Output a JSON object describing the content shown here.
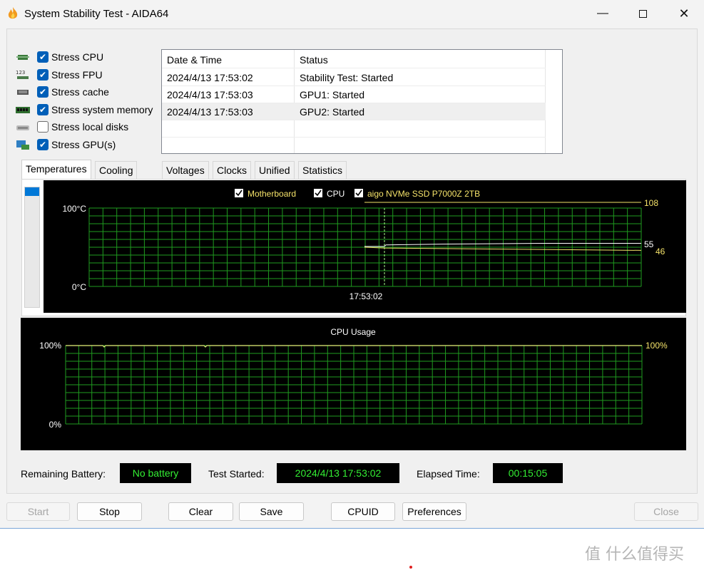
{
  "window": {
    "title": "System Stability Test - AIDA64"
  },
  "stress_items": [
    {
      "label": "Stress CPU",
      "checked": true,
      "icon": "cpu-icon"
    },
    {
      "label": "Stress FPU",
      "checked": true,
      "icon": "fpu-icon"
    },
    {
      "label": "Stress cache",
      "checked": true,
      "icon": "cache-icon"
    },
    {
      "label": "Stress system memory",
      "checked": true,
      "icon": "memory-icon"
    },
    {
      "label": "Stress local disks",
      "checked": false,
      "icon": "disk-icon"
    },
    {
      "label": "Stress GPU(s)",
      "checked": true,
      "icon": "gpu-icon"
    }
  ],
  "log": {
    "headers": [
      "Date & Time",
      "Status"
    ],
    "rows": [
      [
        "2024/4/13 17:53:02",
        "Stability Test: Started"
      ],
      [
        "2024/4/13 17:53:03",
        "GPU1: Started"
      ],
      [
        "2024/4/13 17:53:03",
        "GPU2: Started"
      ]
    ]
  },
  "tabs": [
    "Temperatures",
    "Cooling Fans",
    "Voltages",
    "Clocks",
    "Unified",
    "Statistics"
  ],
  "temp_chart": {
    "legend": [
      {
        "label": "Motherboard",
        "checked": true,
        "color": "#f5e36a"
      },
      {
        "label": "CPU",
        "checked": true,
        "color": "#ffffff"
      },
      {
        "label": "aigo NVMe SSD P7000Z 2TB",
        "checked": true,
        "color": "#f5e36a"
      }
    ],
    "y_top": "100°C",
    "y_bottom": "0°C",
    "x_label": "17:53:02",
    "right_values": [
      "108",
      "55",
      "46"
    ]
  },
  "cpu_chart": {
    "title": "CPU Usage",
    "y_top": "100%",
    "y_bottom": "0%",
    "right_value": "100%"
  },
  "chart_data": [
    {
      "type": "line",
      "title": "",
      "ylim": [
        0,
        100
      ],
      "unit": "°C",
      "series": [
        {
          "name": "Motherboard",
          "color": "#f5e36a",
          "current": 46
        },
        {
          "name": "CPU",
          "color": "#ffffff",
          "current": 55
        },
        {
          "name": "aigo NVMe SSD P7000Z 2TB",
          "color": "#f5e36a",
          "current": 108
        }
      ]
    },
    {
      "type": "line",
      "title": "CPU Usage",
      "ylim": [
        0,
        100
      ],
      "unit": "%",
      "series": [
        {
          "name": "CPU Usage",
          "current": 100
        }
      ]
    }
  ],
  "status": {
    "battery_label": "Remaining Battery:",
    "battery_value": "No battery",
    "started_label": "Test Started:",
    "started_value": "2024/4/13 17:53:02",
    "elapsed_label": "Elapsed Time:",
    "elapsed_value": "00:15:05"
  },
  "buttons": {
    "start": "Start",
    "stop": "Stop",
    "clear": "Clear",
    "save": "Save",
    "cpuid": "CPUID",
    "preferences": "Preferences",
    "close": "Close"
  },
  "watermark": "值 什么值得买"
}
